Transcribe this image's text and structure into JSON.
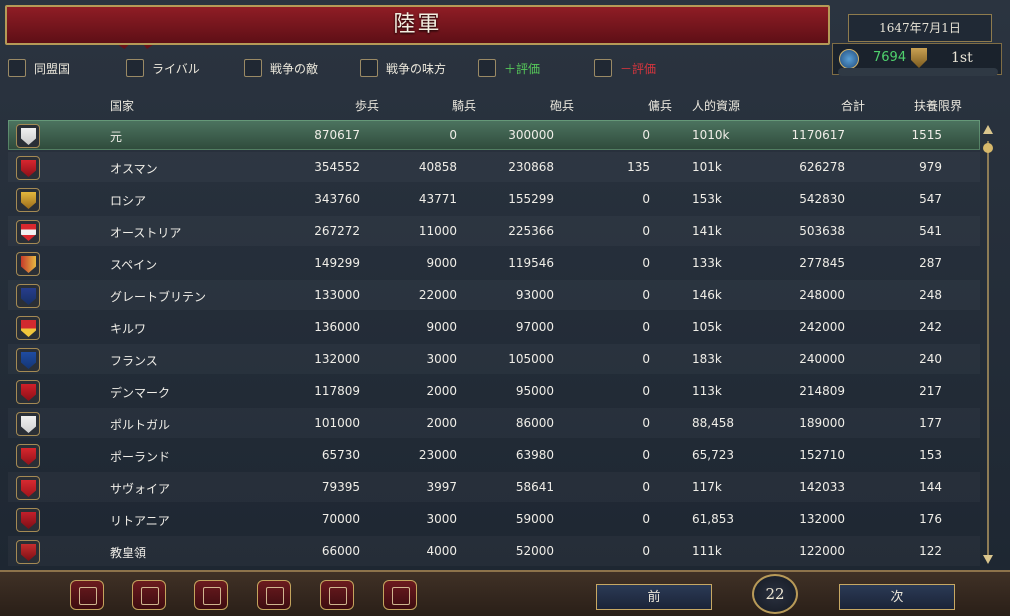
{
  "window": {
    "title": "陸軍",
    "date": "1647年7月1日",
    "score": "7694",
    "rank": "1st"
  },
  "filters": [
    {
      "label": "同盟国"
    },
    {
      "label": "ライバル"
    },
    {
      "label": "戦争の敵"
    },
    {
      "label": "戦争の味方"
    },
    {
      "label": "＋評価"
    },
    {
      "label": "－評価"
    }
  ],
  "table": {
    "headers": [
      "国家",
      "歩兵",
      "騎兵",
      "砲兵",
      "傭兵",
      "人的資源",
      "合計",
      "扶養限界"
    ],
    "rows": [
      {
        "country": "元",
        "infantry": "870617",
        "cavalry": "0",
        "artillery": "300000",
        "mercs": "0",
        "manpower": "1010k",
        "total": "1170617",
        "limit": "1515",
        "flag": "ming-flag-icon"
      },
      {
        "country": "オスマン",
        "infantry": "354552",
        "cavalry": "40858",
        "artillery": "230868",
        "mercs": "135",
        "manpower": "101k",
        "total": "626278",
        "limit": "979",
        "flag": "ottoman-flag-icon"
      },
      {
        "country": "ロシア",
        "infantry": "343760",
        "cavalry": "43771",
        "artillery": "155299",
        "mercs": "0",
        "manpower": "153k",
        "total": "542830",
        "limit": "547",
        "flag": "russia-flag-icon"
      },
      {
        "country": "オーストリア",
        "infantry": "267272",
        "cavalry": "11000",
        "artillery": "225366",
        "mercs": "0",
        "manpower": "141k",
        "total": "503638",
        "limit": "541",
        "flag": "austria-flag-icon"
      },
      {
        "country": "スペイン",
        "infantry": "149299",
        "cavalry": "9000",
        "artillery": "119546",
        "mercs": "0",
        "manpower": "133k",
        "total": "277845",
        "limit": "287",
        "flag": "spain-flag-icon"
      },
      {
        "country": "グレートブリテン",
        "infantry": "133000",
        "cavalry": "22000",
        "artillery": "93000",
        "mercs": "0",
        "manpower": "146k",
        "total": "248000",
        "limit": "248",
        "flag": "great-britain-flag-icon"
      },
      {
        "country": "キルワ",
        "infantry": "136000",
        "cavalry": "9000",
        "artillery": "97000",
        "mercs": "0",
        "manpower": "105k",
        "total": "242000",
        "limit": "242",
        "flag": "kilwa-flag-icon"
      },
      {
        "country": "フランス",
        "infantry": "132000",
        "cavalry": "3000",
        "artillery": "105000",
        "mercs": "0",
        "manpower": "183k",
        "total": "240000",
        "limit": "240",
        "flag": "france-flag-icon"
      },
      {
        "country": "デンマーク",
        "infantry": "117809",
        "cavalry": "2000",
        "artillery": "95000",
        "mercs": "0",
        "manpower": "113k",
        "total": "214809",
        "limit": "217",
        "flag": "denmark-flag-icon"
      },
      {
        "country": "ポルトガル",
        "infantry": "101000",
        "cavalry": "2000",
        "artillery": "86000",
        "mercs": "0",
        "manpower": "88,458",
        "total": "189000",
        "limit": "177",
        "flag": "portugal-flag-icon"
      },
      {
        "country": "ポーランド",
        "infantry": "65730",
        "cavalry": "23000",
        "artillery": "63980",
        "mercs": "0",
        "manpower": "65,723",
        "total": "152710",
        "limit": "153",
        "flag": "poland-flag-icon"
      },
      {
        "country": "サヴォイア",
        "infantry": "79395",
        "cavalry": "3997",
        "artillery": "58641",
        "mercs": "0",
        "manpower": "117k",
        "total": "142033",
        "limit": "144",
        "flag": "savoy-flag-icon"
      },
      {
        "country": "リトアニア",
        "infantry": "70000",
        "cavalry": "3000",
        "artillery": "59000",
        "mercs": "0",
        "manpower": "61,853",
        "total": "132000",
        "limit": "176",
        "flag": "lithuania-flag-icon"
      },
      {
        "country": "教皇領",
        "infantry": "66000",
        "cavalry": "4000",
        "artillery": "52000",
        "mercs": "0",
        "manpower": "111k",
        "total": "122000",
        "limit": "122",
        "flag": "papal-state-flag-icon"
      }
    ]
  },
  "pager": {
    "prev": "前",
    "next": "次",
    "page": "22"
  },
  "footer_icons": [
    "ledger-icon",
    "flag-icon",
    "swords-icon",
    "coins-icon",
    "trade-goods-icon",
    "handshake-icon"
  ],
  "colors": {
    "positive": "#56c859",
    "negative": "#d5353d",
    "selected_row": "#4d7460"
  }
}
